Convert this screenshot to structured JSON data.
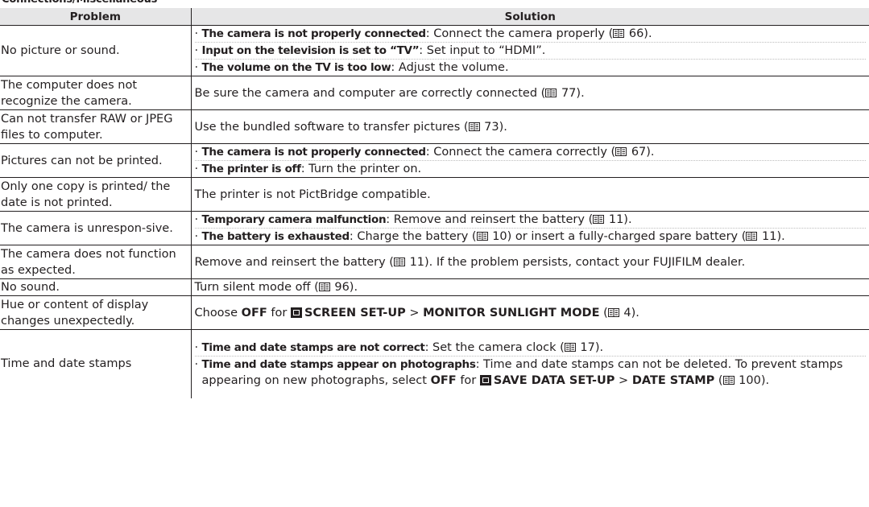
{
  "section_heading": "Connections/Miscellaneous",
  "headers": {
    "problem": "Problem",
    "solution": "Solution"
  },
  "icons": {
    "book": "book-icon",
    "screen_setup": "screen-set-up-menu-icon",
    "save_data": "save-data-set-up-menu-icon"
  },
  "rows": [
    {
      "problem": "No picture or sound.",
      "items": [
        {
          "cause": "The camera is not properly connected",
          "text": ": Connect the camera properly (",
          "ref": "66",
          "end": ")."
        },
        {
          "cause": "Input on the television is set to “TV”",
          "text": ": Set input to “HDMI”."
        },
        {
          "cause": "The volume on the TV is too low",
          "text": ": Adjust the volume."
        }
      ]
    },
    {
      "problem": "The computer does not recognize the camera.",
      "text": "Be sure the camera and computer are correctly connected (",
      "ref": "77",
      "end": ")."
    },
    {
      "problem": "Can not transfer RAW or JPEG files to computer.",
      "text": "Use the bundled software to transfer pictures (",
      "ref": "73",
      "end": ")."
    },
    {
      "problem": "Pictures can not be printed.",
      "items": [
        {
          "cause": "The camera is not properly connected",
          "text": ": Connect the camera correctly (",
          "ref": "67",
          "end": ")."
        },
        {
          "cause": "The printer is off",
          "text": ": Turn the printer on."
        }
      ]
    },
    {
      "problem": "Only one copy is printed/ the date is not printed.",
      "text": "The printer is not PictBridge compatible."
    },
    {
      "problem": "The camera is unrespon-sive.",
      "items": [
        {
          "cause": "Temporary camera malfunction",
          "text": ": Remove and reinsert the battery (",
          "ref": "11",
          "end": ")."
        },
        {
          "cause": "The battery is exhausted",
          "text": ": Charge the battery (",
          "ref": "10",
          "mid": ") or insert a fully-charged spare battery (",
          "ref2": "11",
          "end": ")."
        }
      ]
    },
    {
      "problem": "The camera does not function as expected.",
      "text": "Remove and reinsert the battery (",
      "ref": "11",
      "end": ").  If the problem persists, contact your FUJIFILM dealer."
    },
    {
      "problem": "No sound.",
      "text": "Turn silent mode off (",
      "ref": "96",
      "end": ")."
    },
    {
      "problem": "Hue or content of display changes unexpectedly.",
      "parts": {
        "a": "Choose ",
        "b1": "OFF",
        "c": " for ",
        "b2": "SCREEN SET-UP",
        "d": " > ",
        "b3": "MONITOR SUNLIGHT MODE",
        "e": " (",
        "ref": "4",
        "end": ")."
      }
    },
    {
      "problem": "Time and date stamps",
      "items": [
        {
          "cause": "Time and date stamps are not correct",
          "text": ": Set the camera clock (",
          "ref": "17",
          "end": ")."
        },
        {
          "cause": "Time and date stamps appear on photographs",
          "text": ": Time and date stamps can not be deleted.  To prevent stamps appearing on new photographs, select ",
          "b1": "OFF",
          "c": " for ",
          "b2": "SAVE DATA SET-UP",
          "d": " > ",
          "b3": "DATE STAMP",
          "e": " (",
          "ref": "100",
          "end": ")."
        }
      ]
    }
  ]
}
